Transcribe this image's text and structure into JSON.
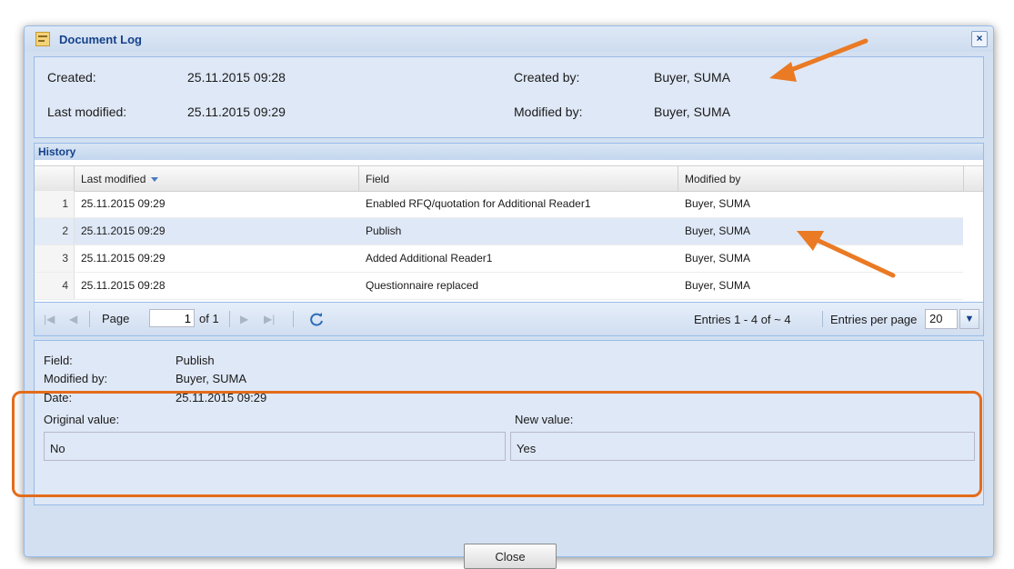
{
  "window": {
    "title": "Document Log"
  },
  "info": {
    "created_label": "Created:",
    "created_value": "25.11.2015 09:28",
    "last_modified_label": "Last modified:",
    "last_modified_value": "25.11.2015 09:29",
    "created_by_label": "Created by:",
    "created_by_value": "Buyer, SUMA",
    "modified_by_label": "Modified by:",
    "modified_by_value": "Buyer, SUMA"
  },
  "history": {
    "title": "History",
    "columns": [
      "Last modified",
      "Field",
      "Modified by"
    ],
    "rows": [
      {
        "num": "1",
        "date": "25.11.2015 09:29",
        "field": "Enabled RFQ/quotation for Additional Reader1",
        "by": "Buyer, SUMA"
      },
      {
        "num": "2",
        "date": "25.11.2015 09:29",
        "field": "Publish",
        "by": "Buyer, SUMA"
      },
      {
        "num": "3",
        "date": "25.11.2015 09:29",
        "field": "Added Additional Reader1",
        "by": "Buyer, SUMA"
      },
      {
        "num": "4",
        "date": "25.11.2015 09:28",
        "field": "Questionnaire replaced",
        "by": "Buyer, SUMA"
      }
    ]
  },
  "pager": {
    "page_label": "Page",
    "page_value": "1",
    "of_label": "of 1",
    "entries_text": "Entries 1 - 4 of ~ 4",
    "per_page_label": "Entries per page",
    "per_page_value": "20"
  },
  "detail": {
    "field_label": "Field:",
    "field_value": "Publish",
    "modified_by_label": "Modified by:",
    "modified_by_value": "Buyer, SUMA",
    "date_label": "Date:",
    "date_value": "25.11.2015 09:29",
    "original_label": "Original value:",
    "original_value": "No",
    "new_label": "New value:",
    "new_value": "Yes"
  },
  "buttons": {
    "close": "Close"
  },
  "colors": {
    "highlight": "#e46c1a",
    "selection": "#dfe8f6",
    "title": "#15428b"
  }
}
